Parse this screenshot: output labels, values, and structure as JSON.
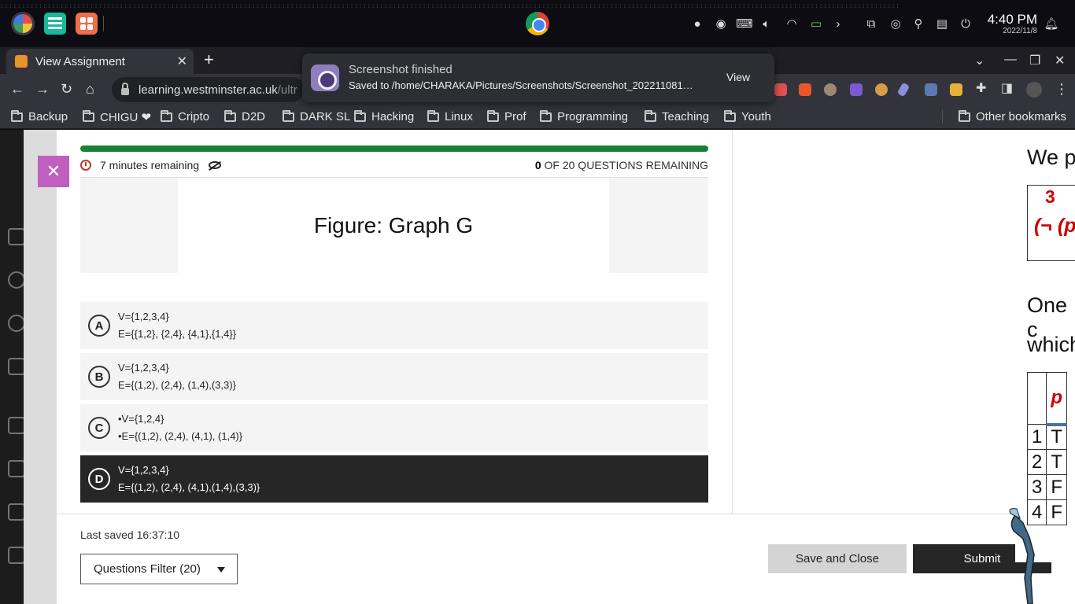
{
  "system": {
    "clock_time": "4:40 PM",
    "clock_date": "2022/11/8"
  },
  "browser": {
    "tab_title": "View Assignment",
    "url_domain": "learning.westminster.ac.uk",
    "url_path": "/ultr",
    "bookmarks": [
      "Backup",
      "CHIGU ❤",
      "Cripto",
      "D2D",
      "DARK SL",
      "Hacking",
      "Linux",
      "Prof",
      "Programming",
      "Teaching",
      "Youth"
    ],
    "other_bookmarks": "Other bookmarks"
  },
  "toast": {
    "title": "Screenshot finished",
    "message": "Saved to /home/CHARAKA/Pictures/Screenshots/Screenshot_202211081…",
    "action": "View"
  },
  "assignment": {
    "progress_fraction": 1.0,
    "time_remaining": "7 minutes remaining",
    "questions_remaining_count": "0",
    "questions_remaining_text": " OF 20 QUESTIONS REMAINING",
    "figure_title": "Figure: Graph G",
    "options": [
      {
        "letter": "A",
        "line1": "V={1,2,3,4}",
        "line2": "E={{1,2}, {2,4}, {4,1},{1,4}}",
        "selected": false
      },
      {
        "letter": "B",
        "line1": "V={1,2,3,4}",
        "line2": "E={(1,2), (2,4), (1,4),(3,3)}",
        "selected": false
      },
      {
        "letter": "C",
        "line1": "•V={1,2,4}",
        "line2": "•E={(1,2), (2,4), (4,1), (1,4)}",
        "selected": false
      },
      {
        "letter": "D",
        "line1": "V={1,2,3,4}",
        "line2": "E={(1,2), (2,4), (4,1),(1,4),(3,3)}",
        "selected": true
      }
    ],
    "last_saved": "Last saved 16:37:10",
    "filter_label": "Questions Filter (20)",
    "save_close_label": "Save and Close",
    "submit_label": "Submit"
  },
  "slide": {
    "line1": "We pr",
    "red_number": "3",
    "red_expr": "(¬ (p",
    "line2": "One c",
    "line3": "which",
    "table": {
      "header": [
        "",
        "p"
      ],
      "rows": [
        [
          "1",
          "T"
        ],
        [
          "2",
          "T"
        ],
        [
          "3",
          "F"
        ],
        [
          "4",
          "F"
        ]
      ]
    }
  },
  "colors": {
    "progress": "#1a7f37",
    "close_button": "#bf5fbf",
    "selected_option": "#262626",
    "submit": "#262626"
  }
}
